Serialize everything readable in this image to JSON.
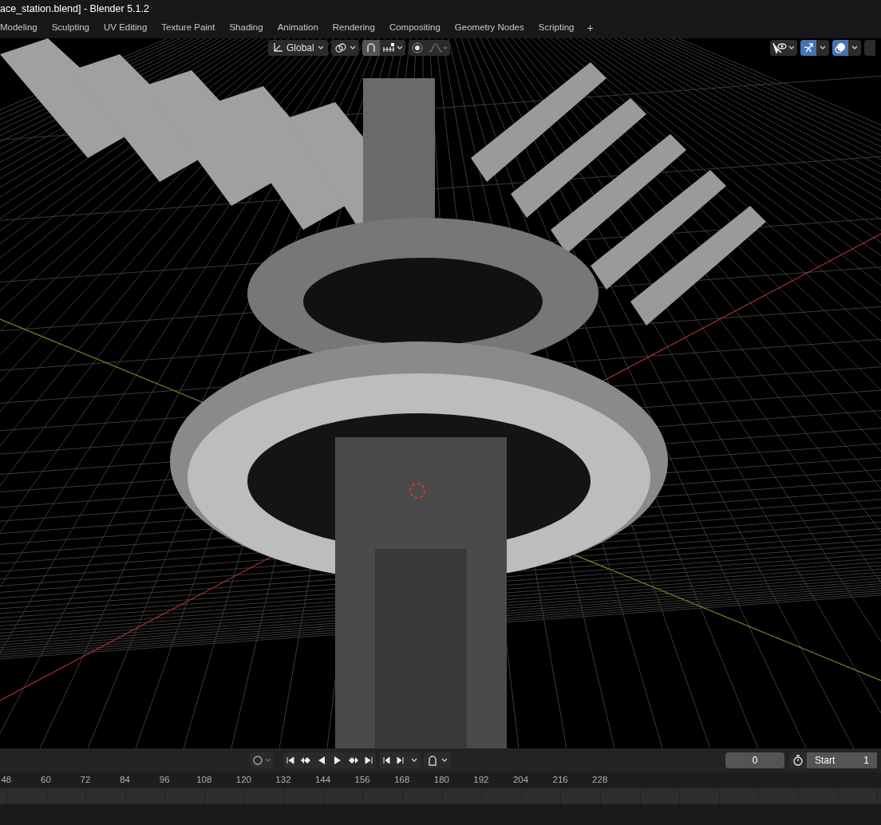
{
  "window": {
    "title": "ace_station.blend] - Blender 5.1.2"
  },
  "workspace_tabs": [
    {
      "label": "Modeling",
      "selected": false
    },
    {
      "label": "Sculpting",
      "selected": false
    },
    {
      "label": "UV Editing",
      "selected": false
    },
    {
      "label": "Texture Paint",
      "selected": false
    },
    {
      "label": "Shading",
      "selected": false
    },
    {
      "label": "Animation",
      "selected": false
    },
    {
      "label": "Rendering",
      "selected": false
    },
    {
      "label": "Compositing",
      "selected": false
    },
    {
      "label": "Geometry Nodes",
      "selected": false
    },
    {
      "label": "Scripting",
      "selected": false
    }
  ],
  "add_tab": "+",
  "viewport_header": {
    "transform_orientation": "Global"
  },
  "timeline": {
    "current_frame": "0",
    "start_label": "Start",
    "start_value": "1",
    "ruler": [
      "48",
      "60",
      "72",
      "84",
      "96",
      "108",
      "120",
      "132",
      "144",
      "156",
      "168",
      "180",
      "192",
      "204",
      "216",
      "228"
    ]
  }
}
